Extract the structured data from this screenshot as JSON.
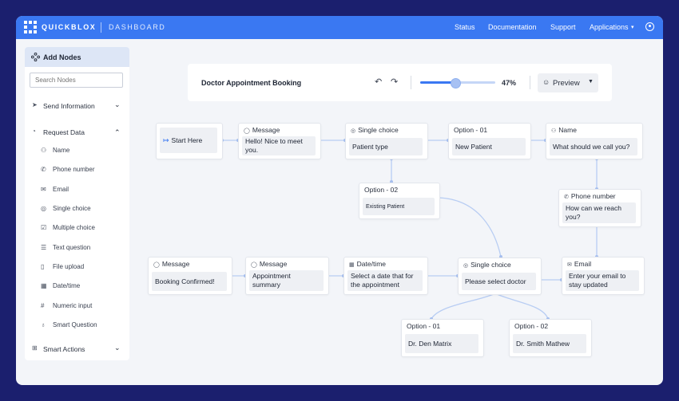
{
  "header": {
    "brand": "QUICKBLOX",
    "subtitle": "DASHBOARD",
    "nav": [
      "Status",
      "Documentation",
      "Support",
      "Applications"
    ],
    "applications_caret": "▾"
  },
  "sidebar": {
    "add_nodes": "Add Nodes",
    "search_placeholder": "Search Nodes",
    "send_information": "Send Information",
    "request_data": "Request Data",
    "items": [
      "Name",
      "Phone number",
      "Email",
      "Single choice",
      "Multiple choice",
      "Text question",
      "File upload",
      "Date/time",
      "Numeric input",
      "Smart Question"
    ],
    "smart_actions": "Smart Actions"
  },
  "toolbar": {
    "title": "Doctor Appointment Booking",
    "zoom": "47%",
    "zoom_level": 0.47,
    "preview": "Preview"
  },
  "nodes": {
    "start": {
      "label": "Start Here"
    },
    "msg1": {
      "header": "Message",
      "body": "Hello! Nice to meet you."
    },
    "sc1": {
      "header": "Single choice",
      "body": "Patient type"
    },
    "opt01": {
      "header": "Option - 01",
      "body": "New Patient"
    },
    "name": {
      "header": "Name",
      "body": "What should we call you?"
    },
    "opt02": {
      "header": "Option - 02",
      "body": "Existing Patient"
    },
    "phone": {
      "header": "Phone number",
      "body": "How can we reach you?"
    },
    "email": {
      "header": "Email",
      "body": "Enter your email to stay updated"
    },
    "sc2": {
      "header": "Single choice",
      "body": "Please select doctor"
    },
    "date": {
      "header": "Date/time",
      "body": "Select a date that for the appointment"
    },
    "msg2": {
      "header": "Message",
      "body": "Appointment summary"
    },
    "msg3": {
      "header": "Message",
      "body": "Booking Confirmed!"
    },
    "doc1": {
      "header": "Option - 01",
      "body": "Dr. Den Matrix"
    },
    "doc2": {
      "header": "Option - 02",
      "body": "Dr. Smith Mathew"
    }
  },
  "colors": {
    "frame": "#1b1f6e",
    "accent": "#3a78f2",
    "wire": "#b8cdf3",
    "canvas": "#f3f5f9"
  }
}
